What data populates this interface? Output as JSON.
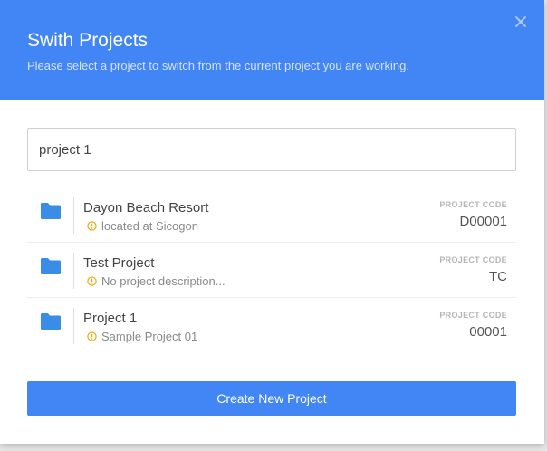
{
  "modal": {
    "title": "Swith Projects",
    "subtitle": "Please select a project to switch from the current project you are working.",
    "close_icon": "close-icon"
  },
  "search": {
    "value": "project 1",
    "placeholder": ""
  },
  "projects": [
    {
      "name": "Dayon Beach Resort",
      "description": "located at Sicogon",
      "code_label": "PROJECT CODE",
      "code": "D00001",
      "icon": "folder-icon",
      "info_icon": "info-icon"
    },
    {
      "name": "Test Project",
      "description": "No project description...",
      "code_label": "PROJECT CODE",
      "code": "TC",
      "icon": "folder-icon",
      "info_icon": "info-icon"
    },
    {
      "name": "Project 1",
      "description": "Sample Project 01",
      "code_label": "PROJECT CODE",
      "code": "00001",
      "icon": "folder-icon",
      "info_icon": "info-icon"
    }
  ],
  "actions": {
    "create_label": "Create New Project"
  },
  "colors": {
    "primary": "#4285f4",
    "folder": "#3a8de6",
    "info": "#f0a500"
  }
}
